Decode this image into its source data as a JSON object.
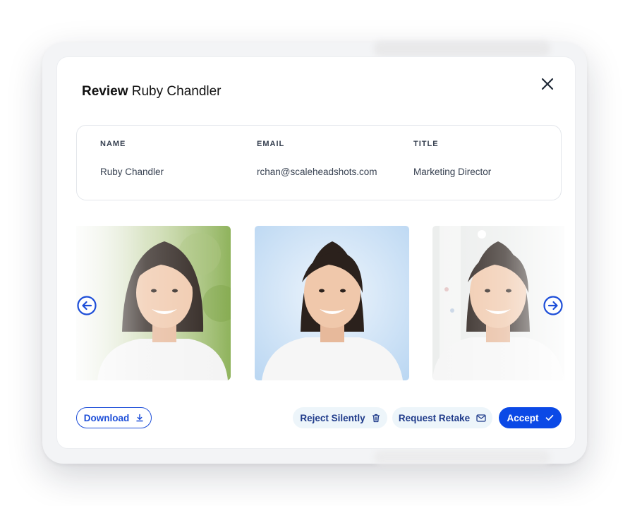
{
  "modal": {
    "title_bold": "Review",
    "title_name": "Ruby Chandler"
  },
  "info": {
    "columns": [
      {
        "header": "NAME",
        "value": "Ruby Chandler"
      },
      {
        "header": "EMAIL",
        "value": "rchan@scaleheadshots.com"
      },
      {
        "header": "TITLE",
        "value": "Marketing Director"
      }
    ]
  },
  "gallery": {
    "photos": [
      {
        "background": "outdoor-green"
      },
      {
        "background": "studio-blue"
      },
      {
        "background": "office-white"
      }
    ]
  },
  "actions": {
    "download": "Download",
    "reject": "Reject Silently",
    "retake": "Request Retake",
    "accept": "Accept"
  },
  "colors": {
    "primary": "#0b49e6",
    "outline": "#1d4ed8",
    "soft_button_bg": "#edf5fa"
  },
  "icons": [
    "close-icon",
    "arrow-left-icon",
    "arrow-right-icon",
    "download-icon",
    "trash-icon",
    "mail-icon",
    "check-icon"
  ]
}
